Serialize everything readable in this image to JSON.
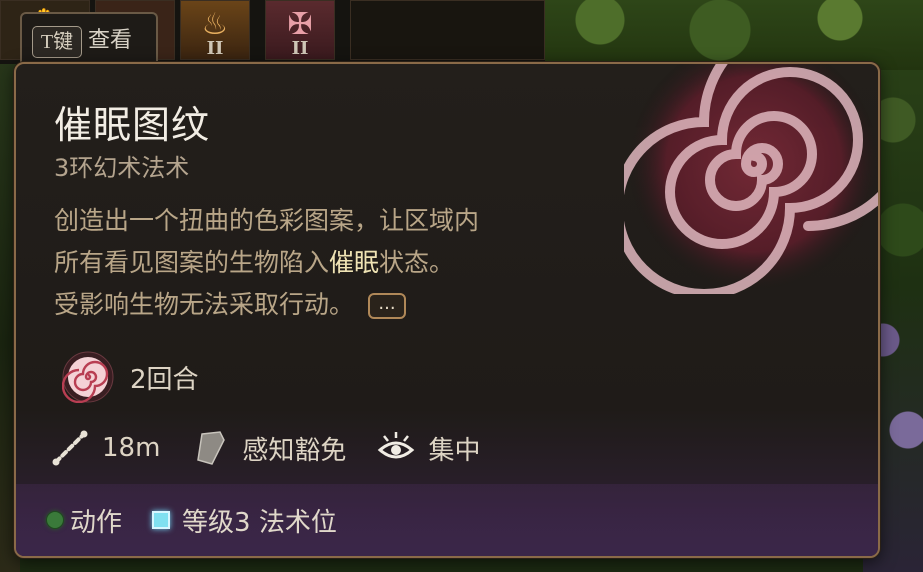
{
  "hotbar": {
    "slot3_rank": "II",
    "slot4_rank": "II"
  },
  "view_tab": {
    "key": "T键",
    "label": "查看"
  },
  "spell": {
    "name": "催眠图纹",
    "subtitle": "3环幻术法术",
    "description": {
      "line1": "创造出一个扭曲的色彩图案，让区域内",
      "line2_pre": "所有看见图案的生物陷入",
      "line2_keyword": "催眠",
      "line2_post": "状态。",
      "line3": "受影响生物无法采取行动。"
    },
    "more_button": "...",
    "duration": "2回合",
    "range": "18m",
    "save": "感知豁免",
    "concentration": "集中"
  },
  "costs": {
    "action": "动作",
    "spell_slot": "等级3 法术位"
  },
  "colors": {
    "accent_frame": "#8a6a48",
    "keyword": "#efe3b4",
    "spell_slot": "#7fe0f0",
    "action": "#3a7a3a"
  }
}
